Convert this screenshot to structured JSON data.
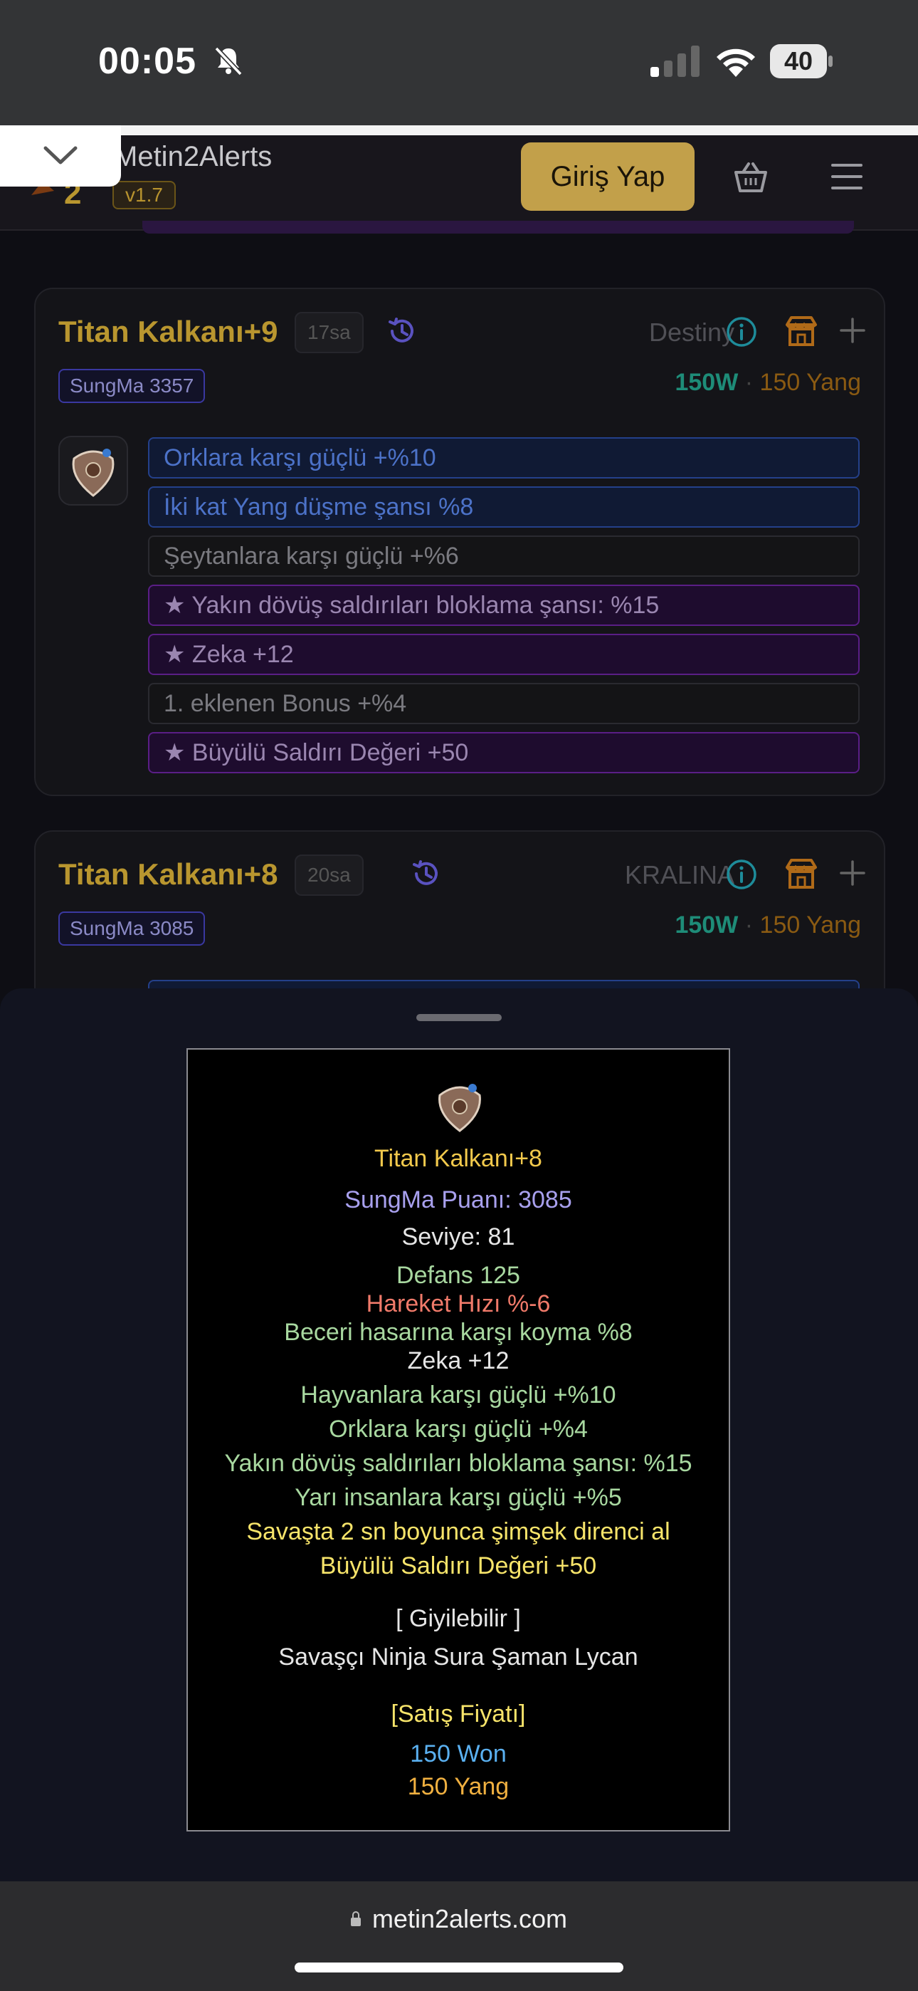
{
  "status_bar": {
    "time": "00:05",
    "battery": "40"
  },
  "header": {
    "brand": "Metin2Alerts",
    "version": "v1.7",
    "login_label": "Giriş Yap"
  },
  "listings": [
    {
      "title": "Titan Kalkanı+9",
      "age": "17sa",
      "seller": "Destiny",
      "score": "SungMa 3357",
      "price_won": "150W",
      "price_sep": "·",
      "price_yang": "150 Yang",
      "bonuses": [
        {
          "text": "Orklara karşı güçlü +%10",
          "style": "blue"
        },
        {
          "text": "İki kat Yang düşme şansı %8",
          "style": "blue"
        },
        {
          "text": "Şeytanlara karşı güçlü +%6",
          "style": "gray"
        },
        {
          "text": "★ Yakın dövüş saldırıları bloklama şansı: %15",
          "style": "purple"
        },
        {
          "text": "★ Zeka +12",
          "style": "purple"
        },
        {
          "text": "1. eklenen Bonus +%4",
          "style": "gray"
        },
        {
          "text": "★ Büyülü Saldırı Değeri +50",
          "style": "purple"
        }
      ]
    },
    {
      "title": "Titan Kalkanı+8",
      "age": "20sa",
      "seller": "KRALINA",
      "score": "SungMa 3085",
      "price_won": "150W",
      "price_sep": "·",
      "price_yang": "150 Yang"
    }
  ],
  "tooltip": {
    "name": "Titan Kalkanı+8",
    "score": "SungMa Puanı: 3085",
    "level": "Seviye: 81",
    "defense": "Defans 125",
    "move_speed": "Hareket Hızı %-6",
    "skill_resist": "Beceri hasarına karşı koyma %8",
    "bonuses": [
      "Zeka +12",
      "Hayvanlara karşı güçlü +%10",
      "Orklara karşı güçlü +%4",
      "Yakın dövüş saldırıları bloklama şansı: %15",
      "Yarı insanlara karşı güçlü +%5"
    ],
    "special": [
      "Savaşta 2 sn boyunca şimşek direnci al",
      "Büyülü Saldırı Değeri +50"
    ],
    "wearable": "[ Giyilebilir ]",
    "classes": "Savaşçı Ninja Sura Şaman Lycan",
    "sale_header": "[Satış Fiyatı]",
    "won": "150 Won",
    "yang": "150 Yang"
  },
  "browser": {
    "url": "metin2alerts.com"
  },
  "colors": {
    "gold_title": "#b9962f",
    "won": "#1e8c78",
    "yang": "#8a5a12",
    "login_bg": "#c2a04a"
  }
}
